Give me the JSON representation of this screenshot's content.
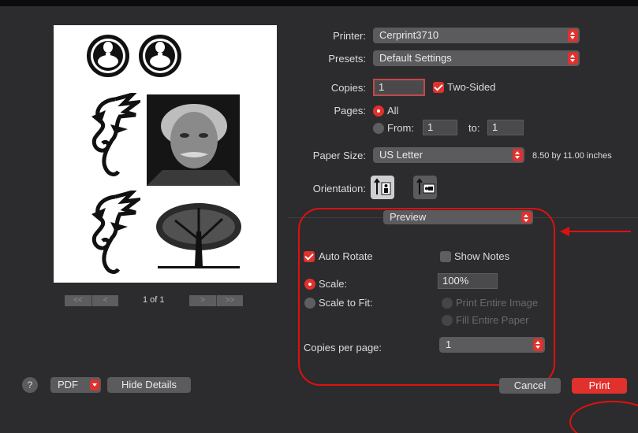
{
  "printer": {
    "label": "Printer:",
    "value": "Cerprint3710"
  },
  "presets": {
    "label": "Presets:",
    "value": "Default Settings"
  },
  "copies": {
    "label": "Copies:",
    "value": "1",
    "two_sided_label": "Two-Sided",
    "two_sided_checked": true
  },
  "pages": {
    "label": "Pages:",
    "all_label": "All",
    "from_label": "From:",
    "from_value": "1",
    "to_label": "to:",
    "to_value": "1",
    "selected": "All"
  },
  "paper_size": {
    "label": "Paper Size:",
    "value": "US Letter",
    "dimensions": "8.50 by 11.00 inches"
  },
  "orientation": {
    "label": "Orientation:",
    "selected": "portrait",
    "icons": [
      "portrait-icon",
      "landscape-icon"
    ]
  },
  "section_popup": {
    "value": "Preview"
  },
  "preview_options": {
    "auto_rotate_label": "Auto Rotate",
    "auto_rotate_checked": true,
    "show_notes_label": "Show Notes",
    "show_notes_checked": false,
    "scale_label": "Scale:",
    "scale_value": "100%",
    "scale_to_fit_label": "Scale to Fit:",
    "print_entire_image_label": "Print Entire Image",
    "fill_entire_paper_label": "Fill Entire Paper",
    "copies_per_page_label": "Copies per page:",
    "copies_per_page_value": "1"
  },
  "pager": {
    "page_text": "1 of 1",
    "first_label": "<<",
    "prev_label": "<",
    "next_label": ">",
    "last_label": ">>"
  },
  "footer": {
    "help_label": "?",
    "pdf_label": "PDF",
    "hide_details_label": "Hide Details",
    "cancel_label": "Cancel",
    "print_label": "Print"
  },
  "colors": {
    "accent": "#e0312d",
    "annotation": "#e01010",
    "background": "#2c2c2e"
  }
}
